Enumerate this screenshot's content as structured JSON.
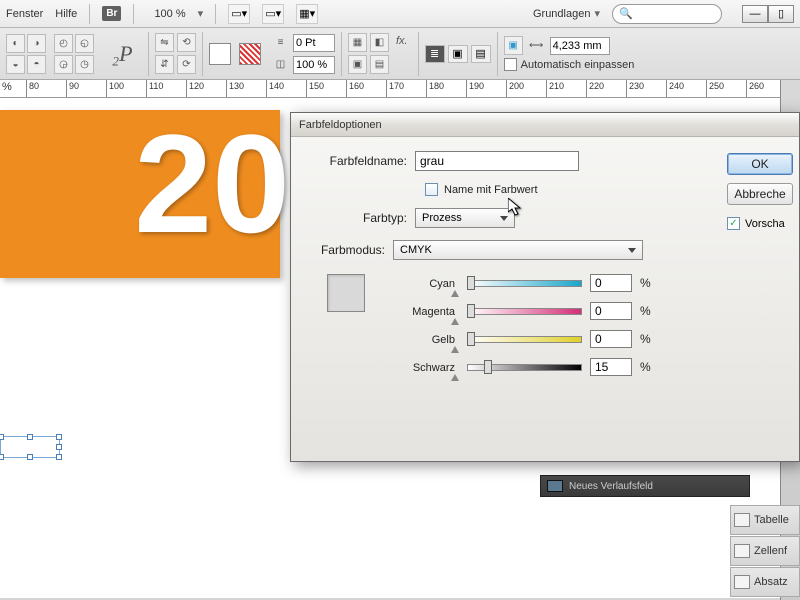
{
  "menu": {
    "fenster": "Fenster",
    "hilfe": "Hilfe",
    "br": "Br",
    "zoom": "100 %",
    "workspace": "Grundlagen"
  },
  "toolbar": {
    "pt_value": "0 Pt",
    "pct_value": "100 %",
    "mm_value": "4,233 mm",
    "auto_fit": "Automatisch einpassen"
  },
  "ruler": {
    "pct": "%",
    "values": [
      "80",
      "90",
      "100",
      "110",
      "120",
      "130",
      "140",
      "150",
      "160",
      "170",
      "180",
      "190",
      "200",
      "210",
      "220",
      "230",
      "240",
      "250",
      "260"
    ]
  },
  "canvas": {
    "big_number": "20"
  },
  "dialog": {
    "title": "Farbfeldoptionen",
    "name_label": "Farbfeldname:",
    "name_value": "grau",
    "name_with_value": "Name mit Farbwert",
    "type_label": "Farbtyp:",
    "type_value": "Prozess",
    "mode_label": "Farbmodus:",
    "mode_value": "CMYK",
    "cyan_label": "Cyan",
    "magenta_label": "Magenta",
    "yellow_label": "Gelb",
    "black_label": "Schwarz",
    "cyan_value": "0",
    "magenta_value": "0",
    "yellow_value": "0",
    "black_value": "15",
    "pct": "%",
    "ok": "OK",
    "cancel": "Abbreche",
    "preview": "Vorscha"
  },
  "panels": {
    "neues": "Neues Verlaufsfeld",
    "tabelle": "Tabelle",
    "zellen": "Zellenf",
    "absatz": "Absatz"
  }
}
